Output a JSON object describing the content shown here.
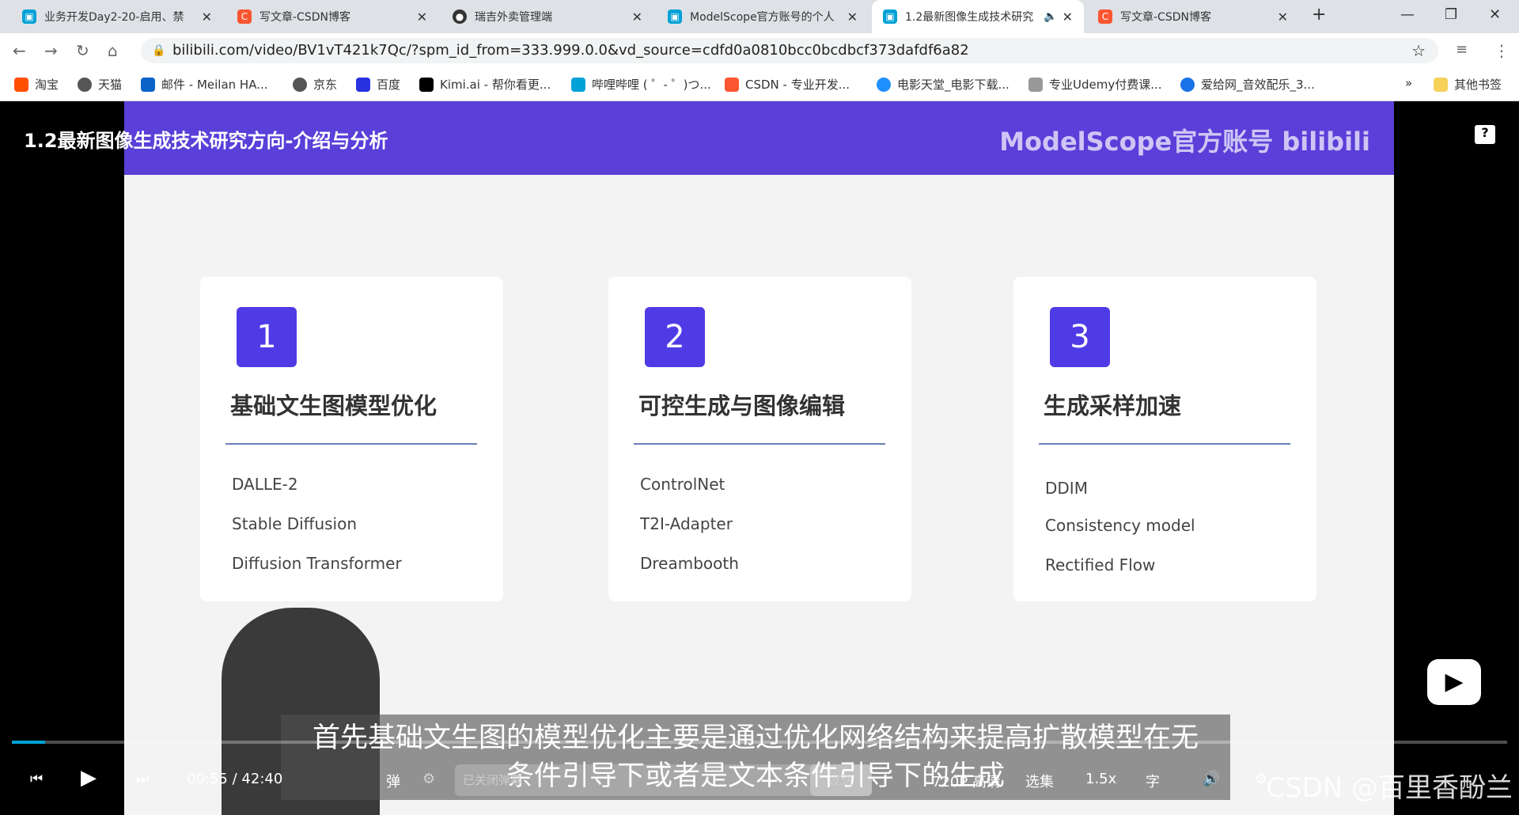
{
  "browser": {
    "tabs": [
      {
        "title": "业务开发Day2-20-启用、禁",
        "icon": "bilibili-icon",
        "color": "#00a1d6"
      },
      {
        "title": "写文章-CSDN博客",
        "icon": "csdn-icon",
        "color": "#fc5531"
      },
      {
        "title": "瑞吉外卖管理端",
        "icon": "ruiji-icon",
        "color": "#333"
      },
      {
        "title": "ModelScope官方账号的个人",
        "icon": "bilibili-icon",
        "color": "#00a1d6"
      },
      {
        "title": "1.2最新图像生成技术研究",
        "icon": "bilibili-icon",
        "color": "#00a1d6",
        "active": true
      },
      {
        "title": "写文章-CSDN博客",
        "icon": "csdn-icon",
        "color": "#fc5531"
      }
    ],
    "url": "bilibili.com/video/BV1vT421k7Qc/?spm_id_from=333.999.0.0&vd_source=cdfd0a0810bcc0bcdbcf373dafdf6a82",
    "bookmarks": [
      "淘宝",
      "天猫",
      "邮件 - Meilan HA...",
      "京东",
      "百度",
      "Kimi.ai - 帮你看更...",
      "哔哩哔哩 ( ゜- ゜)つ...",
      "CSDN - 专业开发...",
      "电影天堂_电影下载...",
      "专业Udemy付费课...",
      "爱给网_音效配乐_3..."
    ],
    "more": "»",
    "other_bookmarks": "其他书签"
  },
  "video": {
    "title": "1.2最新图像生成技术研究方向-介绍与分析",
    "brand": "ModelScope官方账号 bilibili",
    "cards": [
      {
        "num": "1",
        "title": "基础文生图模型优化",
        "items": [
          "DALLE-2",
          "Stable Diffusion",
          "Diffusion Transformer"
        ]
      },
      {
        "num": "2",
        "title": "可控生成与图像编辑",
        "items": [
          "ControlNet",
          "T2I-Adapter",
          "Dreambooth"
        ]
      },
      {
        "num": "3",
        "title": "生成采样加速",
        "items": [
          "DDIM",
          "Consistency model",
          "Rectified Flow"
        ]
      }
    ],
    "subtitle_line1": "首先基础文生图的模型优化主要是通过优化网络结构来提高扩散模型在无",
    "subtitle_line2": "条件引导下或者是文本条件引导下的生成",
    "progress_percent": 2.2,
    "current_time": "00:55",
    "separator": "/",
    "duration": "42:40",
    "danmaku_placeholder": "已关闭弹幕",
    "send": "发送",
    "quality": "720P 高清",
    "episodes": "选集",
    "speed": "1.5x",
    "watermark": "CSDN @百里香酚兰",
    "accent": "#00a1d6"
  }
}
